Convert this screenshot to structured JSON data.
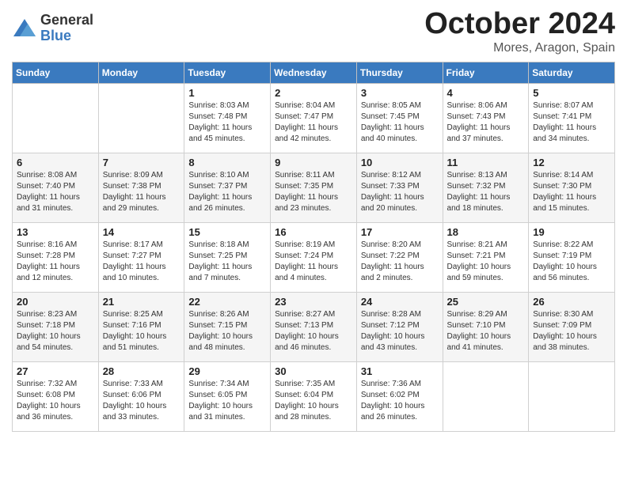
{
  "header": {
    "logo": {
      "general": "General",
      "blue": "Blue"
    },
    "title": "October 2024",
    "location": "Mores, Aragon, Spain"
  },
  "weekdays": [
    "Sunday",
    "Monday",
    "Tuesday",
    "Wednesday",
    "Thursday",
    "Friday",
    "Saturday"
  ],
  "weeks": [
    [
      {
        "day": null,
        "info": null
      },
      {
        "day": null,
        "info": null
      },
      {
        "day": "1",
        "info": "Sunrise: 8:03 AM\nSunset: 7:48 PM\nDaylight: 11 hours and 45 minutes."
      },
      {
        "day": "2",
        "info": "Sunrise: 8:04 AM\nSunset: 7:47 PM\nDaylight: 11 hours and 42 minutes."
      },
      {
        "day": "3",
        "info": "Sunrise: 8:05 AM\nSunset: 7:45 PM\nDaylight: 11 hours and 40 minutes."
      },
      {
        "day": "4",
        "info": "Sunrise: 8:06 AM\nSunset: 7:43 PM\nDaylight: 11 hours and 37 minutes."
      },
      {
        "day": "5",
        "info": "Sunrise: 8:07 AM\nSunset: 7:41 PM\nDaylight: 11 hours and 34 minutes."
      }
    ],
    [
      {
        "day": "6",
        "info": "Sunrise: 8:08 AM\nSunset: 7:40 PM\nDaylight: 11 hours and 31 minutes."
      },
      {
        "day": "7",
        "info": "Sunrise: 8:09 AM\nSunset: 7:38 PM\nDaylight: 11 hours and 29 minutes."
      },
      {
        "day": "8",
        "info": "Sunrise: 8:10 AM\nSunset: 7:37 PM\nDaylight: 11 hours and 26 minutes."
      },
      {
        "day": "9",
        "info": "Sunrise: 8:11 AM\nSunset: 7:35 PM\nDaylight: 11 hours and 23 minutes."
      },
      {
        "day": "10",
        "info": "Sunrise: 8:12 AM\nSunset: 7:33 PM\nDaylight: 11 hours and 20 minutes."
      },
      {
        "day": "11",
        "info": "Sunrise: 8:13 AM\nSunset: 7:32 PM\nDaylight: 11 hours and 18 minutes."
      },
      {
        "day": "12",
        "info": "Sunrise: 8:14 AM\nSunset: 7:30 PM\nDaylight: 11 hours and 15 minutes."
      }
    ],
    [
      {
        "day": "13",
        "info": "Sunrise: 8:16 AM\nSunset: 7:28 PM\nDaylight: 11 hours and 12 minutes."
      },
      {
        "day": "14",
        "info": "Sunrise: 8:17 AM\nSunset: 7:27 PM\nDaylight: 11 hours and 10 minutes."
      },
      {
        "day": "15",
        "info": "Sunrise: 8:18 AM\nSunset: 7:25 PM\nDaylight: 11 hours and 7 minutes."
      },
      {
        "day": "16",
        "info": "Sunrise: 8:19 AM\nSunset: 7:24 PM\nDaylight: 11 hours and 4 minutes."
      },
      {
        "day": "17",
        "info": "Sunrise: 8:20 AM\nSunset: 7:22 PM\nDaylight: 11 hours and 2 minutes."
      },
      {
        "day": "18",
        "info": "Sunrise: 8:21 AM\nSunset: 7:21 PM\nDaylight: 10 hours and 59 minutes."
      },
      {
        "day": "19",
        "info": "Sunrise: 8:22 AM\nSunset: 7:19 PM\nDaylight: 10 hours and 56 minutes."
      }
    ],
    [
      {
        "day": "20",
        "info": "Sunrise: 8:23 AM\nSunset: 7:18 PM\nDaylight: 10 hours and 54 minutes."
      },
      {
        "day": "21",
        "info": "Sunrise: 8:25 AM\nSunset: 7:16 PM\nDaylight: 10 hours and 51 minutes."
      },
      {
        "day": "22",
        "info": "Sunrise: 8:26 AM\nSunset: 7:15 PM\nDaylight: 10 hours and 48 minutes."
      },
      {
        "day": "23",
        "info": "Sunrise: 8:27 AM\nSunset: 7:13 PM\nDaylight: 10 hours and 46 minutes."
      },
      {
        "day": "24",
        "info": "Sunrise: 8:28 AM\nSunset: 7:12 PM\nDaylight: 10 hours and 43 minutes."
      },
      {
        "day": "25",
        "info": "Sunrise: 8:29 AM\nSunset: 7:10 PM\nDaylight: 10 hours and 41 minutes."
      },
      {
        "day": "26",
        "info": "Sunrise: 8:30 AM\nSunset: 7:09 PM\nDaylight: 10 hours and 38 minutes."
      }
    ],
    [
      {
        "day": "27",
        "info": "Sunrise: 7:32 AM\nSunset: 6:08 PM\nDaylight: 10 hours and 36 minutes."
      },
      {
        "day": "28",
        "info": "Sunrise: 7:33 AM\nSunset: 6:06 PM\nDaylight: 10 hours and 33 minutes."
      },
      {
        "day": "29",
        "info": "Sunrise: 7:34 AM\nSunset: 6:05 PM\nDaylight: 10 hours and 31 minutes."
      },
      {
        "day": "30",
        "info": "Sunrise: 7:35 AM\nSunset: 6:04 PM\nDaylight: 10 hours and 28 minutes."
      },
      {
        "day": "31",
        "info": "Sunrise: 7:36 AM\nSunset: 6:02 PM\nDaylight: 10 hours and 26 minutes."
      },
      {
        "day": null,
        "info": null
      },
      {
        "day": null,
        "info": null
      }
    ]
  ]
}
